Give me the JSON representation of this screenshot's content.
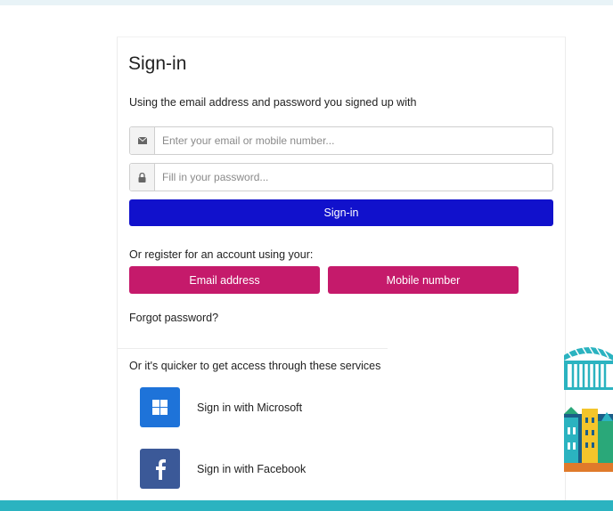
{
  "colors": {
    "primary": "#1111cc",
    "accent": "#c51a6b",
    "microsoft": "#1e73d9",
    "facebook": "#3b5998",
    "footer": "#2bb3c0"
  },
  "signin": {
    "title": "Sign-in",
    "subtitle": "Using the email address and password you signed up with",
    "email": {
      "placeholder": "Enter your email or mobile number...",
      "value": "",
      "icon": "envelope-icon"
    },
    "password": {
      "placeholder": "Fill in your password...",
      "value": "",
      "icon": "lock-icon"
    },
    "submit_label": "Sign-in"
  },
  "register": {
    "prompt": "Or register for an account using your:",
    "email_label": "Email address",
    "mobile_label": "Mobile number"
  },
  "forgot_label": "Forgot password?",
  "services": {
    "prompt": "Or it's quicker to get access through these services",
    "items": [
      {
        "label": "Sign in with Microsoft",
        "icon": "windows-logo-icon"
      },
      {
        "label": "Sign in with Facebook",
        "icon": "facebook-logo-icon"
      }
    ]
  }
}
